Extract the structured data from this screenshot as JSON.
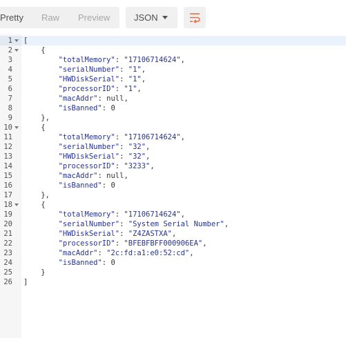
{
  "toolbar": {
    "view_tabs": [
      "Pretty",
      "Raw",
      "Preview"
    ],
    "active_view": "Pretty",
    "format": "JSON",
    "wrap_icon": "line-wrap-icon",
    "accent_color": "#f26b3a"
  },
  "editor": {
    "active_line": 1,
    "lines": [
      {
        "n": "1",
        "fold": true,
        "indent": "",
        "tokens": [
          [
            "punc",
            "["
          ]
        ]
      },
      {
        "n": "2",
        "fold": true,
        "indent": "    ",
        "tokens": [
          [
            "punc",
            "{"
          ]
        ]
      },
      {
        "n": "3",
        "fold": false,
        "indent": "        ",
        "tokens": [
          [
            "key",
            "\"totalMemory\""
          ],
          [
            "punc",
            ": "
          ],
          [
            "str",
            "\"17106714624\""
          ],
          [
            "punc",
            ","
          ]
        ]
      },
      {
        "n": "4",
        "fold": false,
        "indent": "        ",
        "tokens": [
          [
            "key",
            "\"serialNumber\""
          ],
          [
            "punc",
            ": "
          ],
          [
            "str",
            "\"1\""
          ],
          [
            "punc",
            ","
          ]
        ]
      },
      {
        "n": "5",
        "fold": false,
        "indent": "        ",
        "tokens": [
          [
            "key",
            "\"HWDiskSerial\""
          ],
          [
            "punc",
            ": "
          ],
          [
            "str",
            "\"1\""
          ],
          [
            "punc",
            ","
          ]
        ]
      },
      {
        "n": "6",
        "fold": false,
        "indent": "        ",
        "tokens": [
          [
            "key",
            "\"processorID\""
          ],
          [
            "punc",
            ": "
          ],
          [
            "str",
            "\"1\""
          ],
          [
            "punc",
            ","
          ]
        ]
      },
      {
        "n": "7",
        "fold": false,
        "indent": "        ",
        "tokens": [
          [
            "key",
            "\"macAddr\""
          ],
          [
            "punc",
            ": "
          ],
          [
            "null",
            "null"
          ],
          [
            "punc",
            ","
          ]
        ]
      },
      {
        "n": "8",
        "fold": false,
        "indent": "        ",
        "tokens": [
          [
            "key",
            "\"isBanned\""
          ],
          [
            "punc",
            ": "
          ],
          [
            "num",
            "0"
          ]
        ]
      },
      {
        "n": "9",
        "fold": false,
        "indent": "    ",
        "tokens": [
          [
            "punc",
            "},"
          ]
        ]
      },
      {
        "n": "10",
        "fold": true,
        "indent": "    ",
        "tokens": [
          [
            "punc",
            "{"
          ]
        ]
      },
      {
        "n": "11",
        "fold": false,
        "indent": "        ",
        "tokens": [
          [
            "key",
            "\"totalMemory\""
          ],
          [
            "punc",
            ": "
          ],
          [
            "str",
            "\"17106714624\""
          ],
          [
            "punc",
            ","
          ]
        ]
      },
      {
        "n": "12",
        "fold": false,
        "indent": "        ",
        "tokens": [
          [
            "key",
            "\"serialNumber\""
          ],
          [
            "punc",
            ": "
          ],
          [
            "str",
            "\"32\""
          ],
          [
            "punc",
            ","
          ]
        ]
      },
      {
        "n": "13",
        "fold": false,
        "indent": "        ",
        "tokens": [
          [
            "key",
            "\"HWDiskSerial\""
          ],
          [
            "punc",
            ": "
          ],
          [
            "str",
            "\"32\""
          ],
          [
            "punc",
            ","
          ]
        ]
      },
      {
        "n": "14",
        "fold": false,
        "indent": "        ",
        "tokens": [
          [
            "key",
            "\"processorID\""
          ],
          [
            "punc",
            ": "
          ],
          [
            "str",
            "\"3233\""
          ],
          [
            "punc",
            ","
          ]
        ]
      },
      {
        "n": "15",
        "fold": false,
        "indent": "        ",
        "tokens": [
          [
            "key",
            "\"macAddr\""
          ],
          [
            "punc",
            ": "
          ],
          [
            "null",
            "null"
          ],
          [
            "punc",
            ","
          ]
        ]
      },
      {
        "n": "16",
        "fold": false,
        "indent": "        ",
        "tokens": [
          [
            "key",
            "\"isBanned\""
          ],
          [
            "punc",
            ": "
          ],
          [
            "num",
            "0"
          ]
        ]
      },
      {
        "n": "17",
        "fold": false,
        "indent": "    ",
        "tokens": [
          [
            "punc",
            "},"
          ]
        ]
      },
      {
        "n": "18",
        "fold": true,
        "indent": "    ",
        "tokens": [
          [
            "punc",
            "{"
          ]
        ]
      },
      {
        "n": "19",
        "fold": false,
        "indent": "        ",
        "tokens": [
          [
            "key",
            "\"totalMemory\""
          ],
          [
            "punc",
            ": "
          ],
          [
            "str",
            "\"17106714624\""
          ],
          [
            "punc",
            ","
          ]
        ]
      },
      {
        "n": "20",
        "fold": false,
        "indent": "        ",
        "tokens": [
          [
            "key",
            "\"serialNumber\""
          ],
          [
            "punc",
            ": "
          ],
          [
            "str",
            "\"System Serial Number\""
          ],
          [
            "punc",
            ","
          ]
        ]
      },
      {
        "n": "21",
        "fold": false,
        "indent": "        ",
        "tokens": [
          [
            "key",
            "\"HWDiskSerial\""
          ],
          [
            "punc",
            ": "
          ],
          [
            "str",
            "\"Z4ZASTXA\""
          ],
          [
            "punc",
            ","
          ]
        ]
      },
      {
        "n": "22",
        "fold": false,
        "indent": "        ",
        "tokens": [
          [
            "key",
            "\"processorID\""
          ],
          [
            "punc",
            ": "
          ],
          [
            "str",
            "\"BFEBFBFF000906EA\""
          ],
          [
            "punc",
            ","
          ]
        ]
      },
      {
        "n": "23",
        "fold": false,
        "indent": "        ",
        "tokens": [
          [
            "key",
            "\"macAddr\""
          ],
          [
            "punc",
            ": "
          ],
          [
            "str",
            "\"2c:fd:a1:e0:52:cd\""
          ],
          [
            "punc",
            ","
          ]
        ]
      },
      {
        "n": "24",
        "fold": false,
        "indent": "        ",
        "tokens": [
          [
            "key",
            "\"isBanned\""
          ],
          [
            "punc",
            ": "
          ],
          [
            "num",
            "0"
          ]
        ]
      },
      {
        "n": "25",
        "fold": false,
        "indent": "    ",
        "tokens": [
          [
            "punc",
            "}"
          ]
        ]
      },
      {
        "n": "26",
        "fold": false,
        "indent": "",
        "tokens": [
          [
            "punc",
            "]"
          ]
        ]
      }
    ]
  }
}
